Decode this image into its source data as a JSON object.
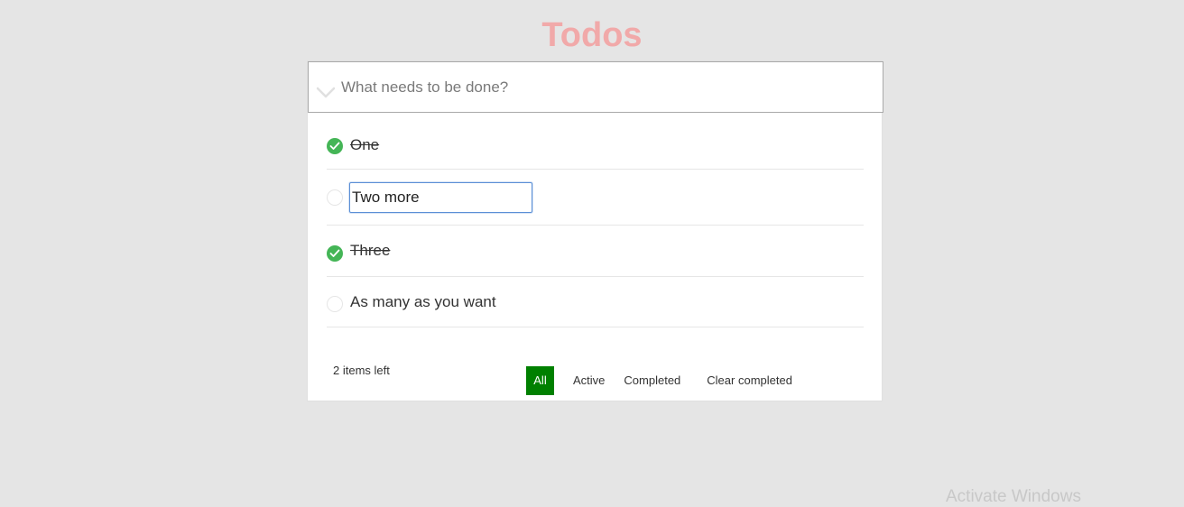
{
  "app": {
    "title": "Todos"
  },
  "header": {
    "new_todo_placeholder": "What needs to be done?",
    "new_todo_value": ""
  },
  "todos": [
    {
      "label": "One",
      "completed": true
    },
    {
      "label": "Two more ",
      "completed": false,
      "editing": true
    },
    {
      "label": "Three",
      "completed": true
    },
    {
      "label": "As many as you want",
      "completed": false
    }
  ],
  "footer": {
    "items_left": "2 items left",
    "filters": {
      "all": "All",
      "active": "Active",
      "completed": "Completed"
    },
    "clear_completed": "Clear completed",
    "selected_filter": "all"
  },
  "colors": {
    "title": "#f1a9a9",
    "check_done": "#44b556",
    "selected_filter_bg": "#008000",
    "background": "#e5e5e5"
  },
  "icons": {
    "toggle_all": "chevron-down-icon",
    "check_done": "check-circle-icon",
    "check_open": "empty-circle-icon"
  },
  "os_overlay": {
    "watermark": "Activate Windows"
  }
}
